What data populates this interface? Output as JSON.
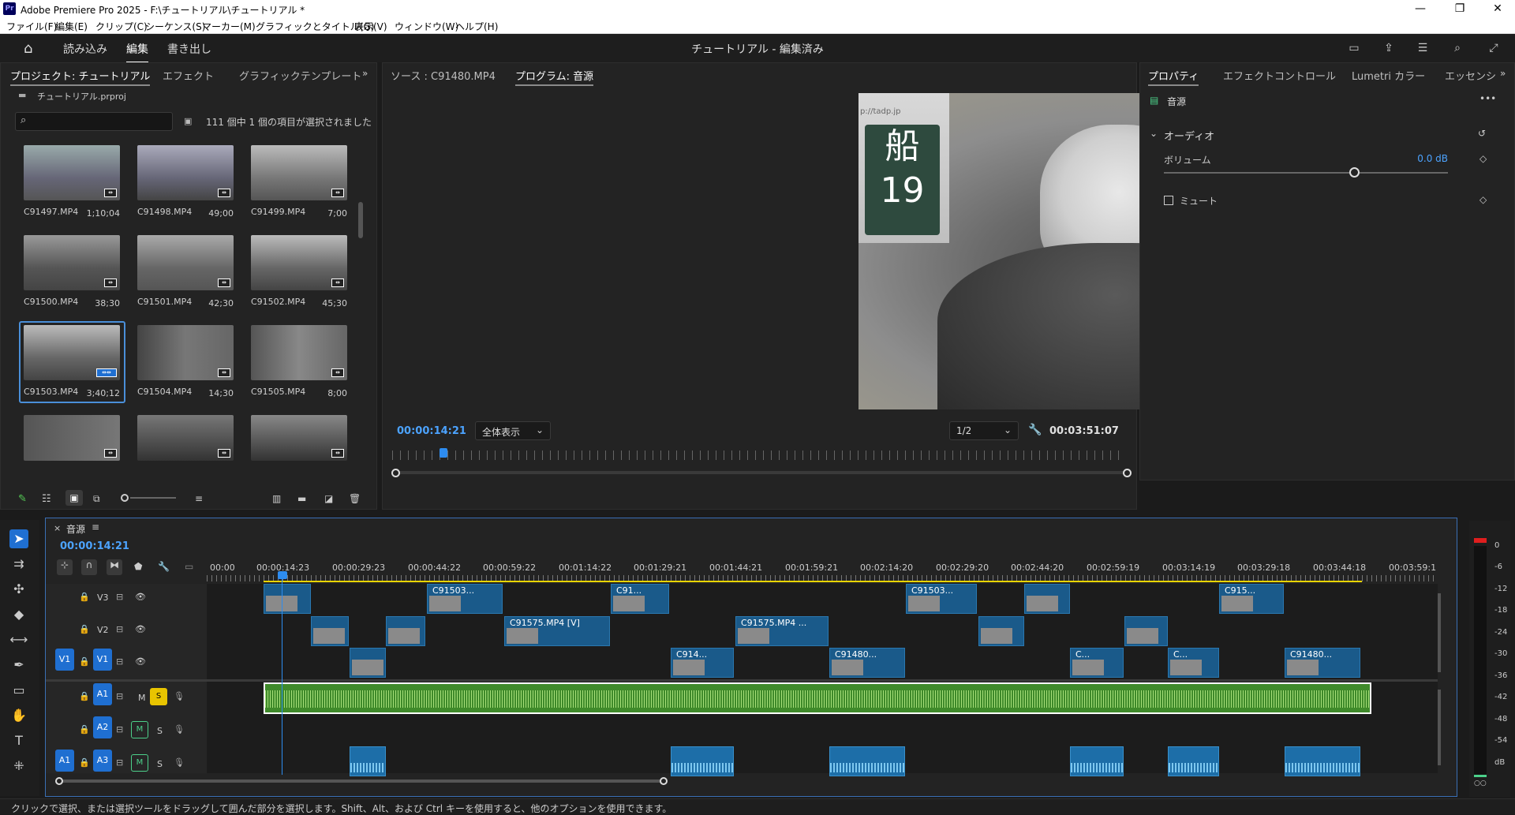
{
  "app": {
    "title": "Adobe Premiere Pro 2025 - F:\\チュートリアル\\チュートリアル *",
    "logo_text": "Pr",
    "menu": [
      "ファイル(F)",
      "編集(E)",
      "クリップ(C)",
      "シーケンス(S)",
      "マーカー(M)",
      "グラフィックとタイトル(G)",
      "表示(V)",
      "ウィンドウ(W)",
      "ヘルプ(H)"
    ]
  },
  "header": {
    "tabs": [
      {
        "label": "読み込み"
      },
      {
        "label": "編集"
      },
      {
        "label": "書き出し"
      }
    ],
    "project_title": "チュートリアル - 編集済み"
  },
  "project_panel": {
    "tabs": [
      "プロジェクト: チュートリアル",
      "エフェクト",
      "グラフィックテンプレート"
    ],
    "file": "チュートリアル.prproj",
    "search_placeholder": "",
    "selection_status": "111 個中 1 個の項目が選択されました",
    "items": [
      {
        "name": "C91497.MP4",
        "dur": "1;10;04"
      },
      {
        "name": "C91498.MP4",
        "dur": "49;00"
      },
      {
        "name": "C91499.MP4",
        "dur": "7;00"
      },
      {
        "name": "C91500.MP4",
        "dur": "38;30"
      },
      {
        "name": "C91501.MP4",
        "dur": "42;30"
      },
      {
        "name": "C91502.MP4",
        "dur": "45;30"
      },
      {
        "name": "C91503.MP4",
        "dur": "3;40;12"
      },
      {
        "name": "C91504.MP4",
        "dur": "14;30"
      },
      {
        "name": "C91505.MP4",
        "dur": "8;00"
      }
    ]
  },
  "monitor": {
    "tabs": [
      "ソース : C91480.MP4",
      "プログラム: 音源"
    ],
    "timecode": "00:00:14:21",
    "zoom": "全体表示",
    "resolution": "1/2",
    "duration": "00:03:51:07",
    "playhead_fraction": 0.064,
    "sign_text": "船\n19",
    "url_text": "p://tadp.jp"
  },
  "properties": {
    "tabs": [
      "プロパティ",
      "エフェクトコントロール",
      "Lumetri カラー",
      "エッセンシ"
    ],
    "clip_name": "音源",
    "section": "オーディオ",
    "volume_label": "ボリューム",
    "volume_value": "0.0 dB",
    "volume_fraction": 0.67,
    "mute_label": "ミュート"
  },
  "timeline": {
    "sequence": "音源",
    "timecode": "00:00:14:21",
    "ruler": [
      "00:00",
      "00:00:14:23",
      "00:00:29:23",
      "00:00:44:22",
      "00:00:59:22",
      "00:01:14:22",
      "00:01:29:21",
      "00:01:44:21",
      "00:01:59:21",
      "00:02:14:20",
      "00:02:29:20",
      "00:02:44:20",
      "00:02:59:19",
      "00:03:14:19",
      "00:03:29:18",
      "00:03:44:18",
      "00:03:59:1"
    ],
    "tracks": {
      "v3": "V3",
      "v2": "V2",
      "v1": "V1",
      "a1": "A1",
      "a2": "A2",
      "a3": "A3",
      "src_v1": "V1",
      "src_a1": "A1",
      "m": "M",
      "s": "S"
    },
    "clips": {
      "v3": [
        "",
        "C91503...",
        "C91...",
        "",
        "C91503...",
        "",
        "C915..."
      ],
      "v2": [
        "",
        "",
        "C91575.MP4 [V]",
        "C91575.MP4 ...",
        "",
        ""
      ],
      "v1": [
        "",
        "C914...",
        "C91480...",
        "C...",
        "C...",
        "C91480..."
      ]
    },
    "meter": [
      "0",
      "-6",
      "-12",
      "-18",
      "-24",
      "-30",
      "-36",
      "-42",
      "-48",
      "-54",
      "dB"
    ]
  },
  "status_bar": "クリックで選択、または選択ツールをドラッグして囲んだ部分を選択します。Shift、Alt、および Ctrl キーを使用すると、他のオプションを使用できます。"
}
